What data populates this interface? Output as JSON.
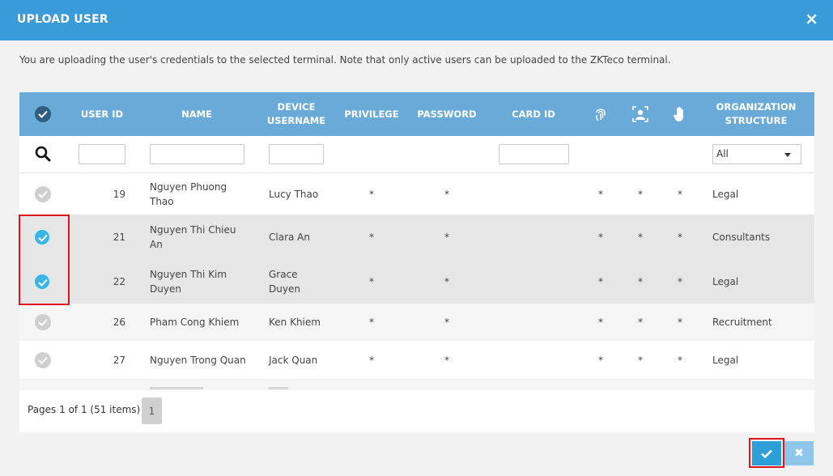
{
  "dialog": {
    "title": "UPLOAD USER",
    "close_glyph": "×",
    "note": "You are uploading the user's credentials to the selected terminal. Note that only active users can be uploaded to the ZKTeco terminal."
  },
  "grid": {
    "columns": {
      "user_id": "USER ID",
      "name": "NAME",
      "device_username": [
        "DEVICE",
        "USERNAME"
      ],
      "privilege": "PRIVILEGE",
      "password": "PASSWORD",
      "card_id": "CARD ID",
      "fingerprint_icon": "fingerprint-icon",
      "face_icon": "face-icon",
      "palm_icon": "palm-icon",
      "organization_structure": [
        "ORGANIZATION",
        "STRUCTURE"
      ]
    },
    "filter": {
      "search_icon": "search-icon",
      "org_select_value": "All"
    },
    "rows": [
      {
        "checked": false,
        "user_id": "19",
        "name": [
          "Nguyen Phuong",
          "Thao"
        ],
        "device_username": [
          "Lucy Thao"
        ],
        "privilege": "*",
        "password": "*",
        "card_id": "",
        "fingerprint": "*",
        "face": "*",
        "palm": "*",
        "org": "Legal"
      },
      {
        "checked": true,
        "user_id": "21",
        "name": [
          "Nguyen Thi Chieu",
          "An"
        ],
        "device_username": [
          "Clara An"
        ],
        "privilege": "*",
        "password": "*",
        "card_id": "",
        "fingerprint": "*",
        "face": "*",
        "palm": "*",
        "org": "Consultants"
      },
      {
        "checked": true,
        "user_id": "22",
        "name": [
          "Nguyen Thi Kim",
          "Duyen"
        ],
        "device_username": [
          "Grace",
          "Duyen"
        ],
        "privilege": "*",
        "password": "*",
        "card_id": "",
        "fingerprint": "*",
        "face": "*",
        "palm": "*",
        "org": "Legal"
      },
      {
        "checked": false,
        "user_id": "26",
        "name": [
          "Pham Cong Khiem"
        ],
        "device_username": [
          "Ken Khiem"
        ],
        "privilege": "*",
        "password": "*",
        "card_id": "",
        "fingerprint": "*",
        "face": "*",
        "palm": "*",
        "org": "Recruitment"
      },
      {
        "checked": false,
        "user_id": "27",
        "name": [
          "Nguyen Trong Quan"
        ],
        "device_username": [
          "Jack Quan"
        ],
        "privilege": "*",
        "password": "*",
        "card_id": "",
        "fingerprint": "*",
        "face": "*",
        "palm": "*",
        "org": "Legal"
      }
    ]
  },
  "pager": {
    "summary": "Pages 1 of 1 (51 items)",
    "current_page": "1"
  },
  "actions": {
    "confirm_icon": "check-icon",
    "cancel_glyph": "✖"
  },
  "colors": {
    "title_bar": "#3a9bd9",
    "grid_header": "#6aaad8",
    "checked": "#3bb4e6",
    "highlight": "#e0141e"
  }
}
